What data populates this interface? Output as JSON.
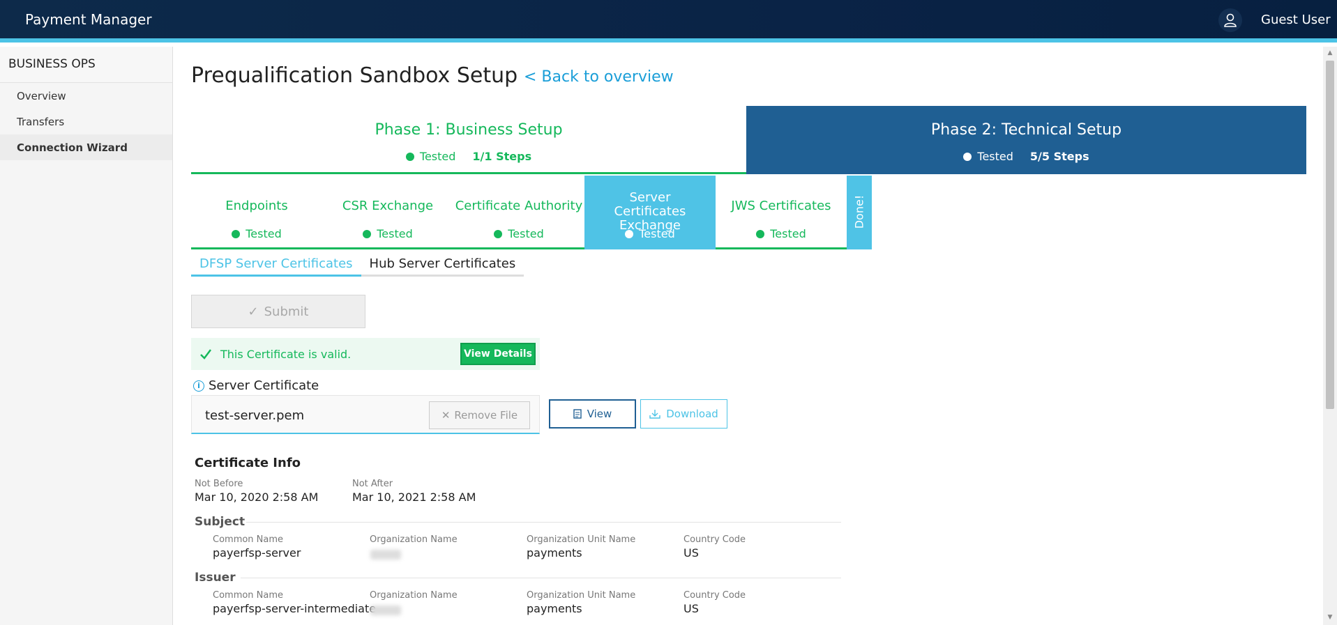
{
  "header": {
    "app_title": "Payment Manager",
    "user_name": "Guest User"
  },
  "sidebar": {
    "section_title": "BUSINESS OPS",
    "items": [
      {
        "label": "Overview"
      },
      {
        "label": "Transfers"
      },
      {
        "label": "Connection Wizard"
      }
    ]
  },
  "page": {
    "title": "Prequalification Sandbox Setup",
    "back_link": "< Back to overview"
  },
  "phases": [
    {
      "title": "Phase 1: Business Setup",
      "status": "Tested",
      "steps": "1/1 Steps"
    },
    {
      "title": "Phase 2: Technical Setup",
      "status": "Tested",
      "steps": "5/5 Steps"
    }
  ],
  "steps": [
    {
      "title": "Endpoints",
      "status": "Tested"
    },
    {
      "title": "CSR Exchange",
      "status": "Tested"
    },
    {
      "title": "Certificate Authority",
      "status": "Tested"
    },
    {
      "title": "Server Certificates Exchange",
      "status": "Tested"
    },
    {
      "title": "JWS Certificates",
      "status": "Tested"
    },
    {
      "title": "Done!"
    }
  ],
  "subtabs": [
    {
      "label": "DFSP Server Certificates"
    },
    {
      "label": "Hub Server Certificates"
    }
  ],
  "submit": {
    "label": "Submit"
  },
  "validation": {
    "message": "This Certificate is valid.",
    "details_label": "View Details"
  },
  "server_certificate": {
    "label": "Server Certificate",
    "file_name": "test-server.pem",
    "remove_label": "Remove File",
    "view_label": "View",
    "download_label": "Download"
  },
  "certificate_info": {
    "title": "Certificate Info",
    "not_before_label": "Not Before",
    "not_before": "Mar 10, 2020 2:58 AM",
    "not_after_label": "Not After",
    "not_after": "Mar 10, 2021 2:58 AM",
    "subject": {
      "title": "Subject",
      "common_name_label": "Common Name",
      "common_name": "payerfsp-server",
      "org_name_label": "Organization Name",
      "org_unit_label": "Organization Unit Name",
      "org_unit": "payments",
      "country_label": "Country Code",
      "country": "US"
    },
    "issuer": {
      "title": "Issuer",
      "common_name_label": "Common Name",
      "common_name": "payerfsp-server-intermediate",
      "org_name_label": "Organization Name",
      "org_unit_label": "Organization Unit Name",
      "org_unit": "payments",
      "country_label": "Country Code",
      "country": "US"
    }
  },
  "colors": {
    "accent": "#4cc3e6",
    "success": "#15b85b",
    "phase_dark": "#1f5f93",
    "header_bg": "#0d2a4a"
  }
}
